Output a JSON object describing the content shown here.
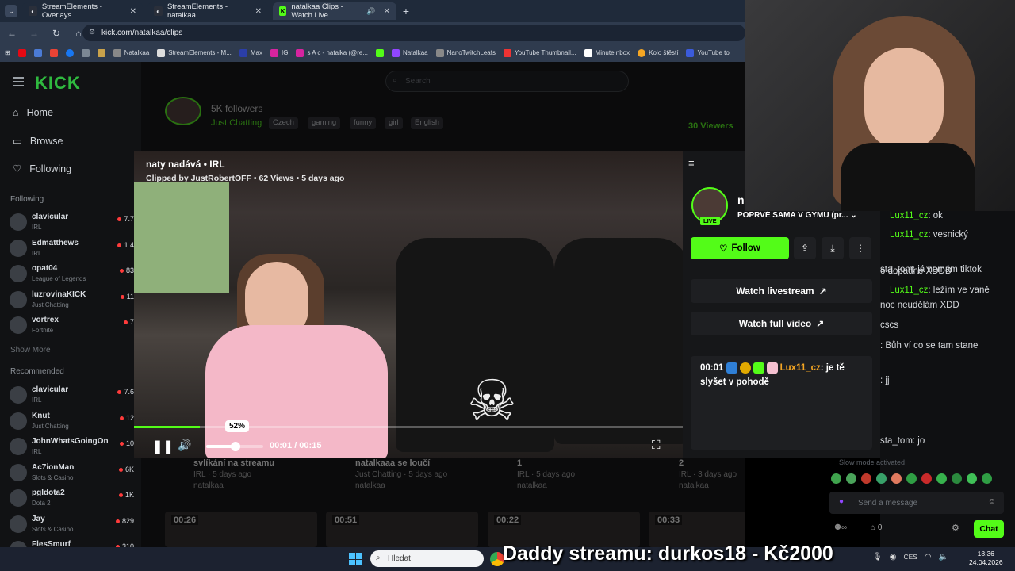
{
  "browser": {
    "tabs": [
      {
        "label": "StreamElements - Overlays",
        "active": false
      },
      {
        "label": "StreamElements - natalkaa",
        "active": false
      },
      {
        "label": "natalkaa Clips - Watch Live",
        "active": true
      }
    ],
    "url": "kick.com/natalkaa/clips",
    "bookmarks": [
      "Natalkaa",
      "StreamElements - M...",
      "Max",
      "IG",
      "s A c - natalka (@re...",
      "Natalkaa",
      "NanoTwitchLeafs",
      "YouTube Thumbnail...",
      "MinuteInbox",
      "Kolo štěstí",
      "YouTube to"
    ]
  },
  "kick": {
    "logo": "KICK",
    "search_placeholder": "Search",
    "nav": {
      "home": "Home",
      "browse": "Browse",
      "following": "Following"
    },
    "following_title": "Following",
    "following": [
      {
        "name": "clavicular",
        "game": "IRL",
        "viewers": "7.7"
      },
      {
        "name": "Edmatthews",
        "game": "IRL",
        "viewers": "1.4"
      },
      {
        "name": "opat04",
        "game": "League of Legends",
        "viewers": "83"
      },
      {
        "name": "luzrovinaKICK",
        "game": "Just Chatting",
        "viewers": "11"
      },
      {
        "name": "vortrex",
        "game": "Fortnite",
        "viewers": "7"
      }
    ],
    "show_more": "Show More",
    "recommended_title": "Recommended",
    "recommended": [
      {
        "name": "clavicular",
        "game": "IRL",
        "viewers": "7.6"
      },
      {
        "name": "Knut",
        "game": "Just Chatting",
        "viewers": "12"
      },
      {
        "name": "JohnWhatsGoingOn",
        "game": "IRL",
        "viewers": "10"
      },
      {
        "name": "Ac7ionMan",
        "game": "Slots & Casino",
        "viewers": "6K"
      },
      {
        "name": "pgldota2",
        "game": "Dota 2",
        "viewers": "1K"
      },
      {
        "name": "Jay",
        "game": "Slots & Casino",
        "viewers": "829"
      },
      {
        "name": "FlesSmurf",
        "game": "",
        "viewers": "310"
      }
    ],
    "profile": {
      "followers": "5K followers",
      "category": "Just Chatting",
      "tags": [
        "Czech",
        "gaming",
        "funny",
        "girl",
        "English"
      ],
      "viewers": "30 Viewers"
    },
    "clips_below": [
      {
        "title": "svlíkání na streamu",
        "meta": "IRL · 5 days ago",
        "author": "natalkaa"
      },
      {
        "title": "natalkaaa se loučí",
        "meta": "Just Chatting · 5 days ago",
        "author": "natalkaa"
      },
      {
        "title": "1",
        "meta": "IRL · 5 days ago",
        "author": "natalkaa"
      },
      {
        "title": "2",
        "meta": "IRL · 3 days ago",
        "author": "natalkaa"
      }
    ],
    "thumb_durations": [
      "00:26",
      "00:51",
      "00:22",
      "00:33"
    ]
  },
  "clip": {
    "title": "naty nadává • IRL",
    "subtitle": "Clipped by JustRobertOFF • 62 Views • 5 days ago",
    "volume_label": "52%",
    "volume": 0.52,
    "progress": 0.12,
    "time": "00:01 / 00:15"
  },
  "side": {
    "live": "LIVE",
    "streamer": "n",
    "stream_title": "POPRVÉ SAMA V GYMU (pr...",
    "follow": "Follow",
    "watch_livestream": "Watch livestream",
    "watch_full": "Watch full video",
    "chat_time": "00:01",
    "chat_user": "Lux11_cz",
    "chat_text": ": je tě slyšet v pohodě"
  },
  "chat": {
    "lines": [
      {
        "user": "Lux11_cz",
        "text": ": ok"
      },
      {
        "user": "Lux11_cz",
        "text": ": vesnický"
      },
      {
        "user": "",
        "text": "o dopadne XDDD"
      },
      {
        "user": "",
        "text": "sta_tom: já nemám tiktok"
      },
      {
        "user": "Lux11_cz",
        "text": ": ležím ve vaně"
      },
      {
        "user": "",
        "text": "noc neudělám XDD"
      },
      {
        "user": "",
        "text": "cscs"
      },
      {
        "user": "",
        "text": ": Bůh ví co se tam stane"
      },
      {
        "user": "",
        "text": ": jj"
      },
      {
        "user": "",
        "text": "sta_tom: jo"
      }
    ],
    "slow_mode": "Slow mode activated",
    "placeholder": "Send a message",
    "points": "0",
    "chat_button": "Chat"
  },
  "taskbar": {
    "search": "Hledat",
    "overlay_text": "Daddy streamu: durkos18 - Kč2000",
    "lang": "CES",
    "time": "18:36",
    "date": "24.04.2026"
  },
  "colors": {
    "accent": "#53fc18",
    "bg": "#0b0b0c"
  }
}
